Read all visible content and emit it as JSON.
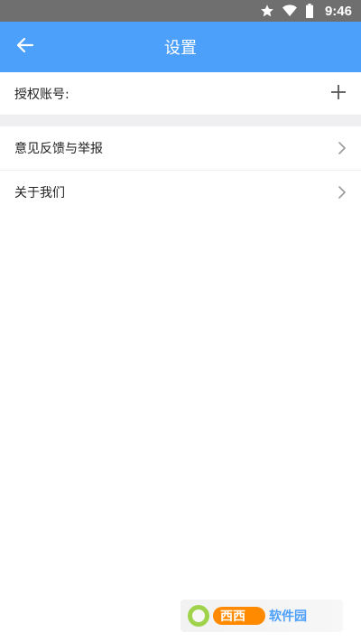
{
  "status_bar": {
    "time": "9:46",
    "icons": [
      "star-icon",
      "wifi-icon",
      "battery-icon"
    ],
    "background_color": "#6f6f6f"
  },
  "app_bar": {
    "title": "设置",
    "back_icon": "arrow-left-icon",
    "background_color": "#4da0fa"
  },
  "settings": {
    "authorized_account": {
      "label": "授权账号:",
      "action_icon": "plus-icon"
    },
    "items": [
      {
        "label": "意见反馈与举报",
        "icon": "chevron-right-icon"
      },
      {
        "label": "关于我们",
        "icon": "chevron-right-icon"
      }
    ]
  },
  "watermark": {
    "text": "西西软件园"
  }
}
